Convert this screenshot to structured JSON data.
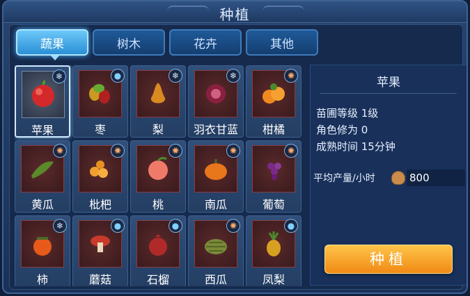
{
  "window": {
    "title": "种植"
  },
  "tabs": [
    {
      "label": "蔬果",
      "active": true
    },
    {
      "label": "树木",
      "active": false
    },
    {
      "label": "花卉",
      "active": false
    },
    {
      "label": "其他",
      "active": false
    }
  ],
  "items": [
    {
      "name": "苹果",
      "badge": "snowflake-icon",
      "fruit": "apple",
      "selected": true
    },
    {
      "name": "枣",
      "badge": "water-drop-icon",
      "fruit": "jujube"
    },
    {
      "name": "梨",
      "badge": "snowflake-icon",
      "fruit": "pear"
    },
    {
      "name": "羽衣甘蓝",
      "badge": "snowflake-icon",
      "fruit": "kale"
    },
    {
      "name": "柑橘",
      "badge": "sun-icon",
      "fruit": "orange"
    },
    {
      "name": "黄瓜",
      "badge": "sun-icon",
      "fruit": "cucumber"
    },
    {
      "name": "枇杷",
      "badge": "sun-icon",
      "fruit": "loquat"
    },
    {
      "name": "桃",
      "badge": "sun-icon",
      "fruit": "peach"
    },
    {
      "name": "南瓜",
      "badge": "sun-icon",
      "fruit": "pumpkin"
    },
    {
      "name": "葡萄",
      "badge": "sun-icon",
      "fruit": "grape"
    },
    {
      "name": "柿",
      "badge": "snowflake-icon",
      "fruit": "persimmon"
    },
    {
      "name": "蘑菇",
      "badge": "water-drop-icon",
      "fruit": "mushroom"
    },
    {
      "name": "石榴",
      "badge": "water-drop-icon",
      "fruit": "pomegranate"
    },
    {
      "name": "西瓜",
      "badge": "sun-icon",
      "fruit": "melon"
    },
    {
      "name": "凤梨",
      "badge": "water-drop-icon",
      "fruit": "pineapple"
    }
  ],
  "detail": {
    "name": "苹果",
    "level": "苗圃等级 1级",
    "cultivation": "角色修为 0",
    "time": "成熟时间 15分钟",
    "yield_label": "平均产量/小时",
    "yield_value": "800"
  },
  "plant_button": "种植",
  "colors": {
    "accent": "#f5a020",
    "tab_active": "#4fb6ff",
    "panel": "#152a4d"
  }
}
